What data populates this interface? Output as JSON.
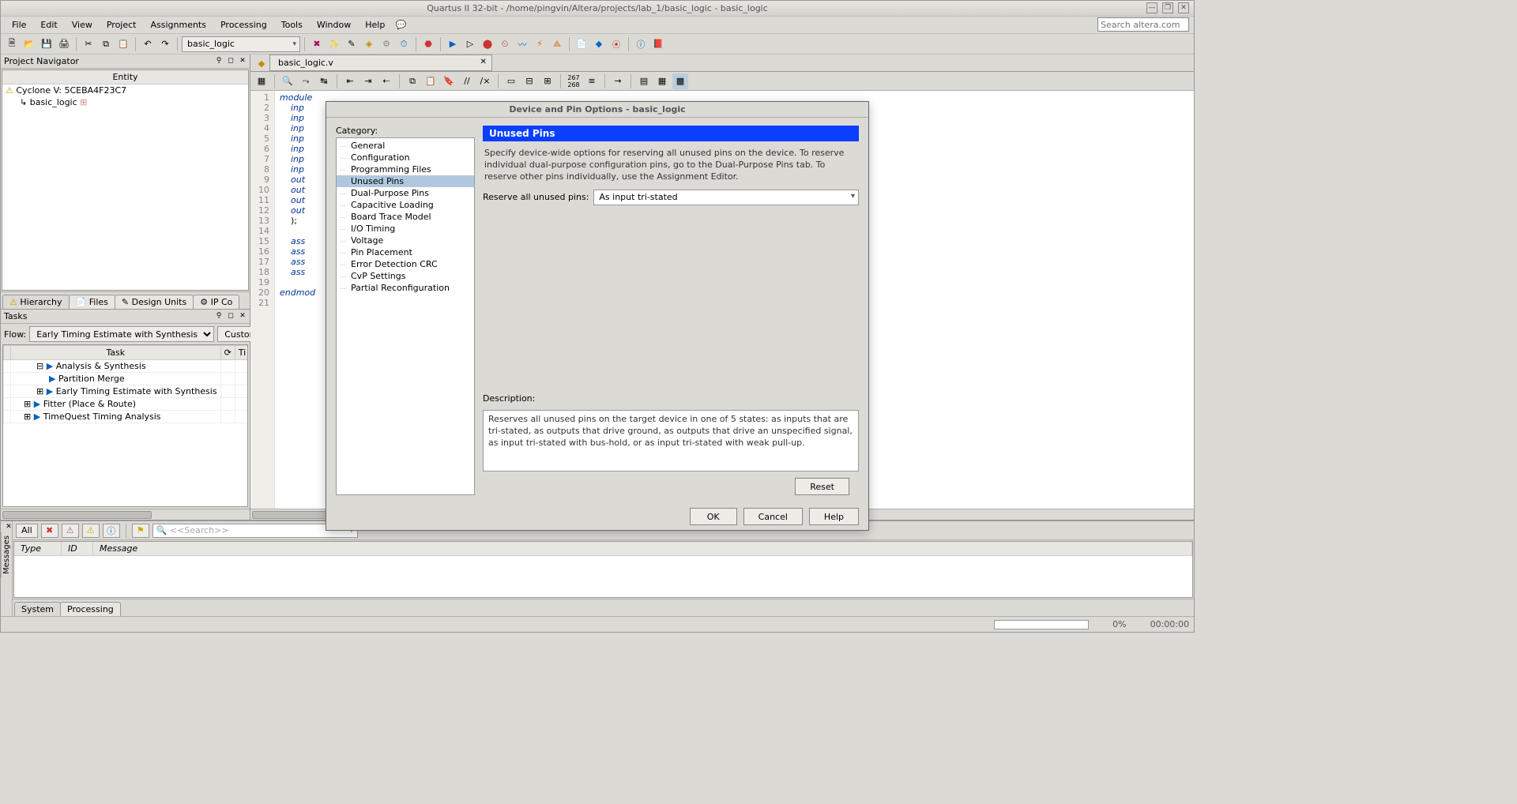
{
  "window": {
    "title": "Quartus II 32-bit - /home/pingvin/Altera/projects/lab_1/basic_logic - basic_logic",
    "minimize": "—",
    "maximize": "❐",
    "close": "✕"
  },
  "menubar": {
    "items": [
      "File",
      "Edit",
      "View",
      "Project",
      "Assignments",
      "Processing",
      "Tools",
      "Window",
      "Help"
    ],
    "search_placeholder": "Search altera.com"
  },
  "main_toolbar": {
    "project_combo": "basic_logic"
  },
  "project_navigator": {
    "title": "Project Navigator",
    "entity_header": "Entity",
    "device": "Cyclone V: 5CEBA4F23C7",
    "top": "basic_logic",
    "tabs": [
      "Hierarchy",
      "Files",
      "Design Units",
      "IP Co"
    ]
  },
  "tasks_panel": {
    "title": "Tasks",
    "flow_label": "Flow:",
    "flow_value": "Early Timing Estimate with Synthesis",
    "customize": "Customize...",
    "columns": [
      "",
      "Task",
      "⟳",
      "Ti"
    ],
    "items": [
      {
        "indent": 1,
        "exp": "⊟",
        "icon": "▶",
        "label": "Analysis & Synthesis"
      },
      {
        "indent": 2,
        "exp": "",
        "icon": "▶",
        "label": "Partition Merge"
      },
      {
        "indent": 1,
        "exp": "⊞",
        "icon": "▶",
        "label": "Early Timing Estimate with Synthesis"
      },
      {
        "indent": 0,
        "exp": "⊞",
        "icon": "▶",
        "label": "Fitter (Place & Route)"
      },
      {
        "indent": 0,
        "exp": "⊞",
        "icon": "▶",
        "label": "TimeQuest Timing Analysis"
      }
    ]
  },
  "editor": {
    "tab_name": "basic_logic.v",
    "lines": [
      {
        "n": 1,
        "t": "module"
      },
      {
        "n": 2,
        "t": "    inp"
      },
      {
        "n": 3,
        "t": "    inp"
      },
      {
        "n": 4,
        "t": "    inp"
      },
      {
        "n": 5,
        "t": "    inp"
      },
      {
        "n": 6,
        "t": "    inp"
      },
      {
        "n": 7,
        "t": "    inp"
      },
      {
        "n": 8,
        "t": "    inp"
      },
      {
        "n": 9,
        "t": "    out"
      },
      {
        "n": 10,
        "t": "    out"
      },
      {
        "n": 11,
        "t": "    out"
      },
      {
        "n": 12,
        "t": "    out"
      },
      {
        "n": 13,
        "t": "    );"
      },
      {
        "n": 14,
        "t": ""
      },
      {
        "n": 15,
        "t": "    ass"
      },
      {
        "n": 16,
        "t": "    ass"
      },
      {
        "n": 17,
        "t": "    ass"
      },
      {
        "n": 18,
        "t": "    ass"
      },
      {
        "n": 19,
        "t": ""
      },
      {
        "n": 20,
        "t": "endmod"
      },
      {
        "n": 21,
        "t": ""
      }
    ]
  },
  "messages": {
    "side_label": "Messages",
    "all_btn": "All",
    "search_placeholder": "<<Search>>",
    "columns": [
      "Type",
      "ID",
      "Message"
    ],
    "tabs": [
      "System",
      "Processing"
    ]
  },
  "statusbar": {
    "progress": "0%",
    "time": "00:00:00"
  },
  "dialog": {
    "title": "Device and Pin Options - basic_logic",
    "category_label": "Category:",
    "categories": [
      "General",
      "Configuration",
      "Programming Files",
      "Unused Pins",
      "Dual-Purpose Pins",
      "Capacitive Loading",
      "Board Trace Model",
      "I/O Timing",
      "Voltage",
      "Pin Placement",
      "Error Detection CRC",
      "CvP Settings",
      "Partial Reconfiguration"
    ],
    "selected_category": "Unused Pins",
    "header": "Unused Pins",
    "intro": "Specify device-wide options for reserving all unused pins on the device. To reserve individual dual-purpose configuration pins, go to the Dual-Purpose Pins tab. To reserve other pins individually, use the Assignment Editor.",
    "reserve_label": "Reserve all unused pins:",
    "reserve_value": "As input tri-stated",
    "description_label": "Description:",
    "description_text": "Reserves all unused pins on the target device in one of 5 states: as inputs that are tri-stated, as outputs that drive ground, as outputs that drive an unspecified signal, as input tri-stated with bus-hold, or as input tri-stated with weak pull-up.",
    "reset_btn": "Reset",
    "ok_btn": "OK",
    "cancel_btn": "Cancel",
    "help_btn": "Help"
  }
}
